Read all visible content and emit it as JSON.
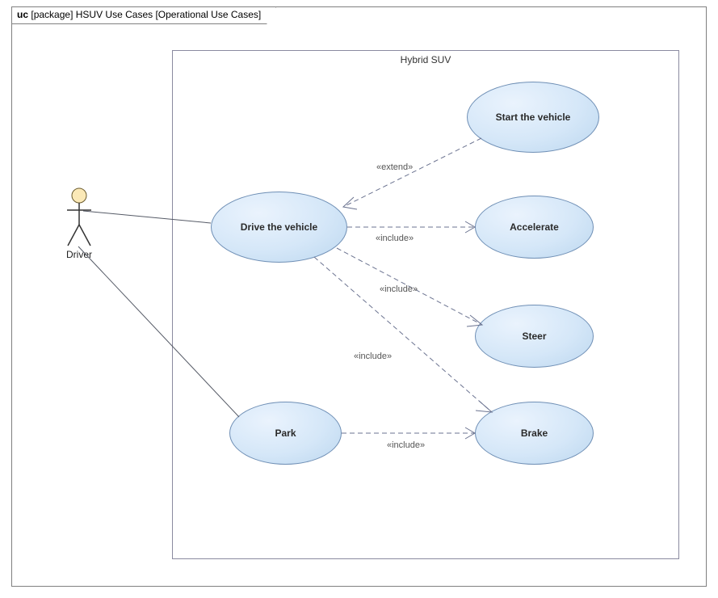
{
  "frame": {
    "kind": "uc",
    "scope": "[package]",
    "title": "HSUV Use Cases",
    "subtitle": "[Operational Use Cases]"
  },
  "system": {
    "title": "Hybrid SUV"
  },
  "actor": {
    "name": "Driver"
  },
  "usecases": {
    "drive": "Drive the vehicle",
    "park": "Park",
    "start": "Start the vehicle",
    "accel": "Accelerate",
    "steer": "Steer",
    "brake": "Brake"
  },
  "relations": {
    "extend": "«extend»",
    "include1": "«include»",
    "include2": "«include»",
    "include3": "«include»",
    "include4": "«include»"
  }
}
